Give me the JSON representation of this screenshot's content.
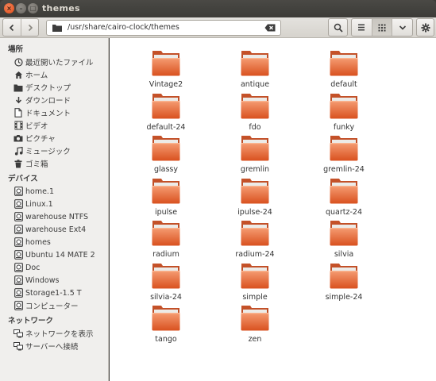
{
  "window": {
    "title": "themes"
  },
  "toolbar": {
    "path": "/usr/share/cairo-clock/themes"
  },
  "sidebar": {
    "sections": [
      {
        "heading": "場所",
        "items": [
          {
            "label": "最近開いたファイル",
            "icon": "recent-clock-icon"
          },
          {
            "label": "ホーム",
            "icon": "home-icon"
          },
          {
            "label": "デスクトップ",
            "icon": "desktop-folder-icon"
          },
          {
            "label": "ダウンロード",
            "icon": "download-arrow-icon"
          },
          {
            "label": "ドキュメント",
            "icon": "document-icon"
          },
          {
            "label": "ビデオ",
            "icon": "film-icon"
          },
          {
            "label": "ピクチャ",
            "icon": "camera-icon"
          },
          {
            "label": "ミュージック",
            "icon": "music-note-icon"
          },
          {
            "label": "ゴミ箱",
            "icon": "trash-icon"
          }
        ]
      },
      {
        "heading": "デバイス",
        "items": [
          {
            "label": "home.1",
            "icon": "drive-icon"
          },
          {
            "label": "Linux.1",
            "icon": "drive-icon"
          },
          {
            "label": "warehouse NTFS",
            "icon": "drive-icon"
          },
          {
            "label": "warehouse Ext4",
            "icon": "drive-icon"
          },
          {
            "label": "homes",
            "icon": "drive-icon"
          },
          {
            "label": "Ubuntu 14 MATE 2",
            "icon": "drive-icon"
          },
          {
            "label": "Doc",
            "icon": "drive-icon"
          },
          {
            "label": "Windows",
            "icon": "drive-icon"
          },
          {
            "label": "Storage1-1.5 T",
            "icon": "drive-icon"
          },
          {
            "label": "コンピューター",
            "icon": "drive-icon"
          }
        ]
      },
      {
        "heading": "ネットワーク",
        "items": [
          {
            "label": "ネットワークを表示",
            "icon": "network-icon"
          },
          {
            "label": "サーバーへ接続",
            "icon": "network-icon"
          }
        ]
      }
    ]
  },
  "files": [
    "Vintage2",
    "antique",
    "default",
    "default-24",
    "fdo",
    "funky",
    "glassy",
    "gremlin",
    "gremlin-24",
    "ipulse",
    "ipulse-24",
    "quartz-24",
    "radium",
    "radium-24",
    "silvia",
    "silvia-24",
    "simple",
    "simple-24",
    "tango",
    "zen"
  ],
  "colors": {
    "accent_orange": "#e8602c",
    "folder_top": "#f28f64",
    "folder_bottom": "#d9511f"
  }
}
